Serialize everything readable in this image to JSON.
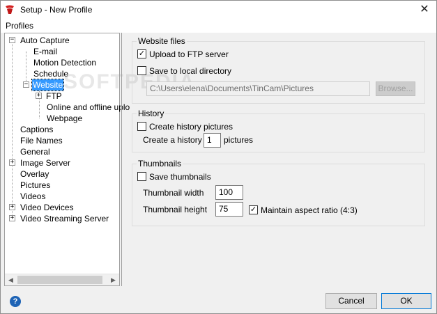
{
  "window": {
    "title": "Setup - New Profile",
    "close_glyph": "✕",
    "icon": "tincam-app-icon"
  },
  "menu": {
    "profiles": "Profiles"
  },
  "tree": {
    "items": [
      {
        "label": "Auto Capture",
        "expander": "−"
      },
      {
        "label": "E-mail"
      },
      {
        "label": "Motion Detection"
      },
      {
        "label": "Schedule"
      },
      {
        "label": "Website",
        "expander": "−",
        "selected": true
      },
      {
        "label": "FTP",
        "expander": "+"
      },
      {
        "label": "Online and offline uplo"
      },
      {
        "label": "Webpage"
      },
      {
        "label": "Captions"
      },
      {
        "label": "File Names"
      },
      {
        "label": "General"
      },
      {
        "label": "Image Server",
        "expander": "+"
      },
      {
        "label": "Overlay"
      },
      {
        "label": "Pictures"
      },
      {
        "label": "Videos"
      },
      {
        "label": "Video Devices",
        "expander": "+"
      },
      {
        "label": "Video Streaming Server",
        "expander": "+"
      }
    ],
    "scroll_left": "◀",
    "scroll_right": "▶"
  },
  "website_files": {
    "title": "Website files",
    "upload_ftp": {
      "label": "Upload to FTP server",
      "checked": "✓"
    },
    "save_local": {
      "label": "Save to local directory",
      "checked": ""
    },
    "directory_value": "C:\\Users\\elena\\Documents\\TinCam\\Pictures",
    "browse_label": "Browse..."
  },
  "history": {
    "title": "History",
    "create_history": {
      "label": "Create history pictures",
      "checked": ""
    },
    "prefix": "Create a history of",
    "count": "1",
    "suffix": "pictures"
  },
  "thumbnails": {
    "title": "Thumbnails",
    "save_thumbnails": {
      "label": "Save thumbnails",
      "checked": ""
    },
    "width_label": "Thumbnail width",
    "width_value": "100",
    "height_label": "Thumbnail height",
    "height_value": "75",
    "maintain_aspect": {
      "label": "Maintain aspect ratio (4:3)",
      "checked": "✓"
    }
  },
  "footer": {
    "help_glyph": "?",
    "cancel_label": "Cancel",
    "ok_label": "OK"
  },
  "watermark": "SOFTPEDIA"
}
